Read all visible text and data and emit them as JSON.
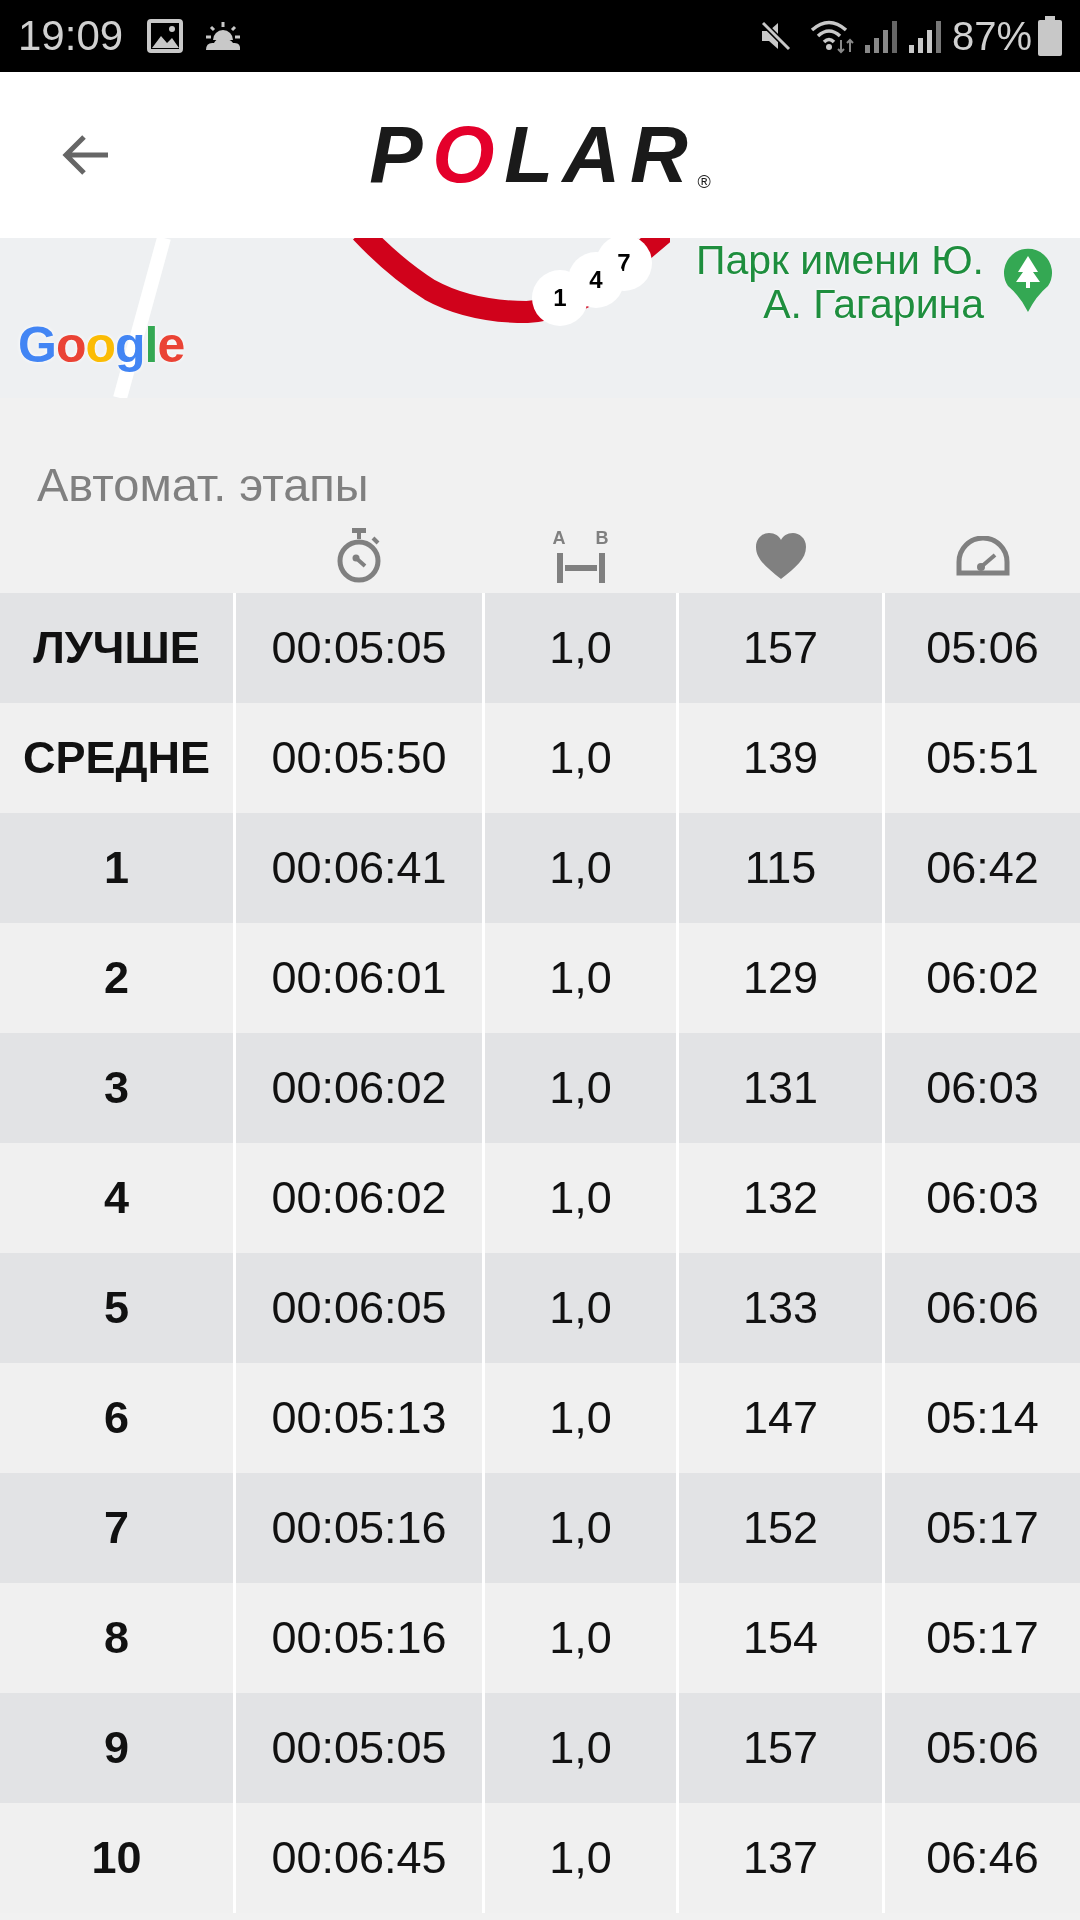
{
  "status_bar": {
    "time": "19:09",
    "battery": "87%"
  },
  "header": {
    "logo": "POLAR",
    "registered_mark": "®"
  },
  "map": {
    "place_label": [
      "Парк имени Ю.",
      "А. Гагарина"
    ],
    "lap_markers": [
      "1",
      "4",
      "7"
    ],
    "attribution": "Google"
  },
  "laps": {
    "title": "Автомат. этапы",
    "columns": [
      {
        "kind": "label"
      },
      {
        "kind": "duration"
      },
      {
        "kind": "distance",
        "end_labels": [
          "A",
          "B"
        ]
      },
      {
        "kind": "heart_rate"
      },
      {
        "kind": "pace"
      }
    ],
    "rows": [
      {
        "cells": [
          "ЛУЧШЕ",
          "00:05:05",
          "1,0",
          "157",
          "05:06"
        ]
      },
      {
        "cells": [
          "СРЕДНЕ",
          "00:05:50",
          "1,0",
          "139",
          "05:51"
        ]
      },
      {
        "cells": [
          "1",
          "00:06:41",
          "1,0",
          "115",
          "06:42"
        ]
      },
      {
        "cells": [
          "2",
          "00:06:01",
          "1,0",
          "129",
          "06:02"
        ]
      },
      {
        "cells": [
          "3",
          "00:06:02",
          "1,0",
          "131",
          "06:03"
        ]
      },
      {
        "cells": [
          "4",
          "00:06:02",
          "1,0",
          "132",
          "06:03"
        ]
      },
      {
        "cells": [
          "5",
          "00:06:05",
          "1,0",
          "133",
          "06:06"
        ]
      },
      {
        "cells": [
          "6",
          "00:05:13",
          "1,0",
          "147",
          "05:14"
        ]
      },
      {
        "cells": [
          "7",
          "00:05:16",
          "1,0",
          "152",
          "05:17"
        ]
      },
      {
        "cells": [
          "8",
          "00:05:16",
          "1,0",
          "154",
          "05:17"
        ]
      },
      {
        "cells": [
          "9",
          "00:05:05",
          "1,0",
          "157",
          "05:06"
        ]
      },
      {
        "cells": [
          "10",
          "00:06:45",
          "1,0",
          "137",
          "06:46"
        ]
      }
    ]
  }
}
